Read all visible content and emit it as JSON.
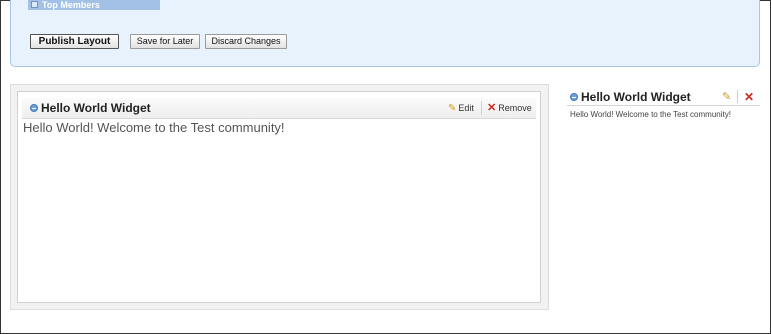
{
  "top_panel": {
    "top_members_label": "Top Members",
    "publish_label": "Publish Layout",
    "save_later_label": "Save for Later",
    "discard_label": "Discard Changes"
  },
  "main_widget": {
    "title": "Hello World Widget",
    "edit_label": "Edit",
    "remove_label": "Remove",
    "body": "Hello World! Welcome to the Test community!"
  },
  "side_widget": {
    "title": "Hello World Widget",
    "body": "Hello World! Welcome to the Test community!"
  },
  "icons": {
    "collapse": "collapse-icon",
    "edit": "pencil-icon",
    "remove": "close-icon"
  },
  "colors": {
    "panel_bg": "#e8f2fd",
    "panel_border": "#a7c7e9",
    "edit_icon": "#d49a18",
    "remove_icon": "#cc2a1e"
  }
}
